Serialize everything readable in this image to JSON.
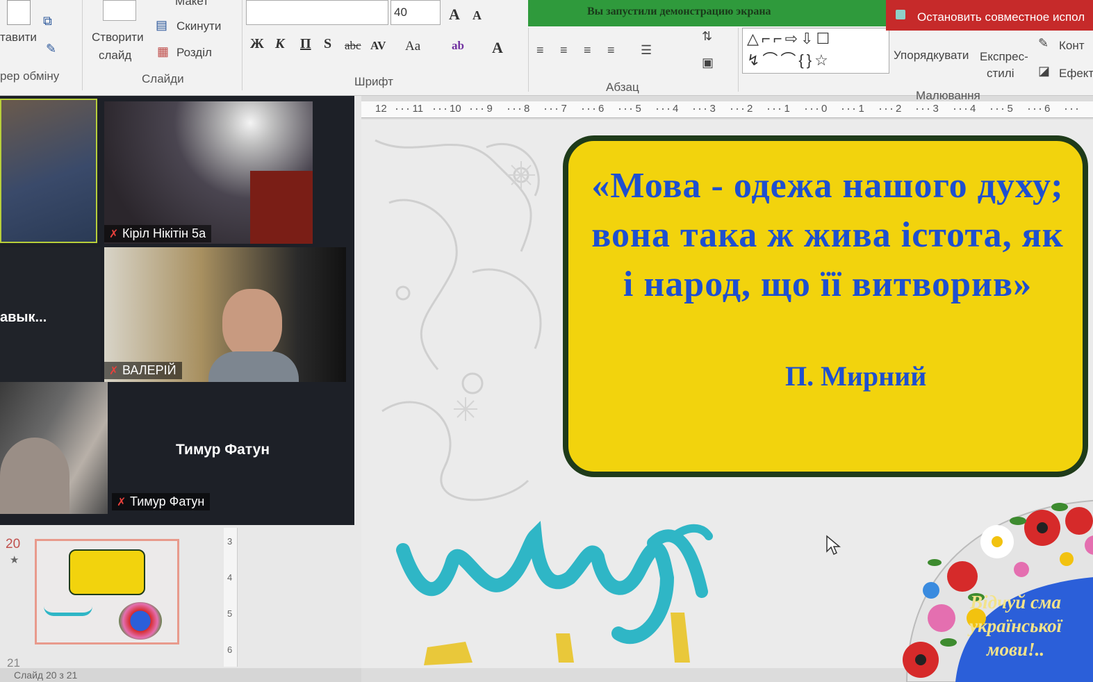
{
  "ribbon": {
    "clipboard": {
      "paste": "тавити",
      "group": "рер обміну"
    },
    "slides": {
      "new_slide_line1": "Створити",
      "new_slide_line2": "слайд",
      "layout": "Макет",
      "reset": "Скинути",
      "section": "Розділ",
      "group": "Слайди"
    },
    "font": {
      "size": "40",
      "bold": "Ж",
      "italic": "К",
      "underline": "П",
      "shadow": "S",
      "strike": "abc",
      "spacing": "AV",
      "case": "Aa",
      "group": "Шрифт"
    },
    "paragraph": {
      "group": "Абзац"
    },
    "drawing": {
      "arrange": "Упорядкувати",
      "styles_line1": "Експрес-",
      "styles_line2": "стилі",
      "outline": "Конт",
      "effects": "Ефект",
      "group": "Малювання"
    }
  },
  "share": {
    "notice": "Вы запустили демонстрацию экрана",
    "stop": "Остановить совместное испол"
  },
  "zoom": {
    "participants": [
      {
        "label": "Кіріл Нікітін 5а"
      },
      {
        "label": "ВАЛЕРІЙ"
      },
      {
        "label": "Тимур Фатун"
      }
    ],
    "cut_name": "авык...",
    "center_name": "Тимур Фатун"
  },
  "ruler": [
    "12",
    "11",
    "10",
    "9",
    "8",
    "7",
    "6",
    "5",
    "4",
    "3",
    "2",
    "1",
    "0",
    "1",
    "2",
    "3",
    "4",
    "5",
    "6"
  ],
  "vruler": [
    "3",
    "4",
    "5",
    "6"
  ],
  "thumbnails": {
    "current": "20",
    "next": "21"
  },
  "status": "Слайд 20 з 21",
  "slide": {
    "quote": "«Мова - одежа нашого духу; вона така ж жива істота, як і народ, що її витворив»",
    "author": "П. Мирний",
    "logo": "цінуй",
    "banner_line1": "Відчуй сма",
    "banner_line2": "української",
    "banner_line3": "мови!.."
  }
}
